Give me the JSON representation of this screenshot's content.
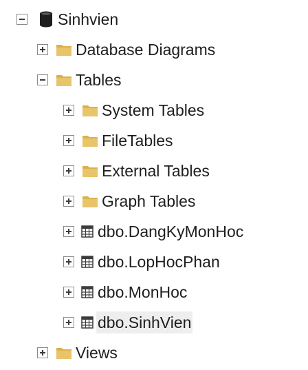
{
  "tree": {
    "root": {
      "label": "Sinhvien",
      "icon": "database-icon",
      "expanded": true
    },
    "database_diagrams": {
      "label": "Database Diagrams",
      "icon": "folder-icon",
      "expanded": false
    },
    "tables": {
      "label": "Tables",
      "icon": "folder-icon",
      "expanded": true,
      "children": [
        {
          "label": "System Tables",
          "icon": "folder-icon",
          "expanded": false
        },
        {
          "label": "FileTables",
          "icon": "folder-icon",
          "expanded": false
        },
        {
          "label": "External Tables",
          "icon": "folder-icon",
          "expanded": false
        },
        {
          "label": "Graph Tables",
          "icon": "folder-icon",
          "expanded": false
        },
        {
          "label": "dbo.DangKyMonHoc",
          "icon": "table-grid-icon",
          "expanded": false
        },
        {
          "label": "dbo.LopHocPhan",
          "icon": "table-grid-icon",
          "expanded": false
        },
        {
          "label": "dbo.MonHoc",
          "icon": "table-grid-icon",
          "expanded": false
        },
        {
          "label": "dbo.SinhVien",
          "icon": "table-grid-icon",
          "expanded": false,
          "selected": true
        }
      ]
    },
    "views": {
      "label": "Views",
      "icon": "folder-icon",
      "expanded": false
    }
  },
  "colors": {
    "folder": "#dcb14b",
    "database": "#1e1e1e",
    "table_grid": "#3c3c3c",
    "selection": "#eeeeee"
  }
}
